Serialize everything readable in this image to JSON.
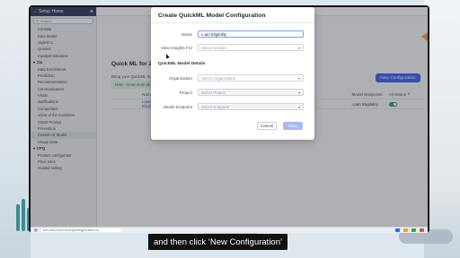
{
  "sidebar": {
    "title": "Setup Home",
    "search_placeholder": "Search",
    "items": [
      {
        "label": "Console",
        "type": "item"
      },
      {
        "label": "Data Model",
        "type": "item"
      },
      {
        "label": "Stylesh L",
        "type": "item"
      },
      {
        "label": "Queries",
        "type": "item"
      },
      {
        "label": "Catalyst Solutions",
        "type": "item"
      },
      {
        "label": "Zia",
        "type": "section"
      },
      {
        "label": "Data Enrichment",
        "type": "item"
      },
      {
        "label": "Prediction",
        "type": "item"
      },
      {
        "label": "Recommendation",
        "type": "item"
      },
      {
        "label": "Communication",
        "type": "item"
      },
      {
        "label": "Vision",
        "type": "item"
      },
      {
        "label": "Notifications",
        "type": "item"
      },
      {
        "label": "Competitors",
        "type": "item"
      },
      {
        "label": "Voice of the Customer",
        "type": "item"
      },
      {
        "label": "Smart Prompt",
        "type": "item"
      },
      {
        "label": "Prevention",
        "type": "item"
      },
      {
        "label": "Custom AI Studio",
        "type": "item",
        "active": true
      },
      {
        "label": "Usage Data",
        "type": "item"
      },
      {
        "label": "CPQ",
        "type": "section"
      },
      {
        "label": "Product configurator",
        "type": "item"
      },
      {
        "label": "Price rules",
        "type": "item"
      },
      {
        "label": "Guided selling",
        "type": "item"
      }
    ]
  },
  "main": {
    "title": "Quick ML for Zo",
    "subtitle": "Bring your QuickML mo",
    "note": "Note : Know more ab",
    "new_config_label": "New Configuration",
    "table": {
      "headers": [
        "Name",
        "",
        "Model Endpoints",
        "All Status"
      ],
      "rows": [
        {
          "name": "Loan Eligibili",
          "endpoint": "Loan Eligibility",
          "status_on": true
        }
      ]
    }
  },
  "modal": {
    "title": "Create QuickML Model Configuration",
    "name_label": "Name",
    "name_value": "Loan Eligibility",
    "view_insights_label": "View Insights For",
    "view_insights_placeholder": "Select Module",
    "section_title": "QuickML Model Details",
    "organization_label": "Organization",
    "organization_placeholder": "Select Organization",
    "project_label": "Project",
    "project_placeholder": "Select Project",
    "endpoint_label": "Model Endpoint",
    "endpoint_placeholder": "Select Endpoint",
    "cancel_label": "Cancel",
    "next_label": "Next"
  },
  "taskbar": {
    "url": "krm.zoho.com/crm/org/settings/custom-ai"
  },
  "caption": "and then click ‘New Configuration’",
  "colors": {
    "accent": "#3b63f3",
    "toggle_on": "#2eaa55",
    "sidebar_header": "#2f3b59",
    "note_bg": "#dff3e4"
  }
}
